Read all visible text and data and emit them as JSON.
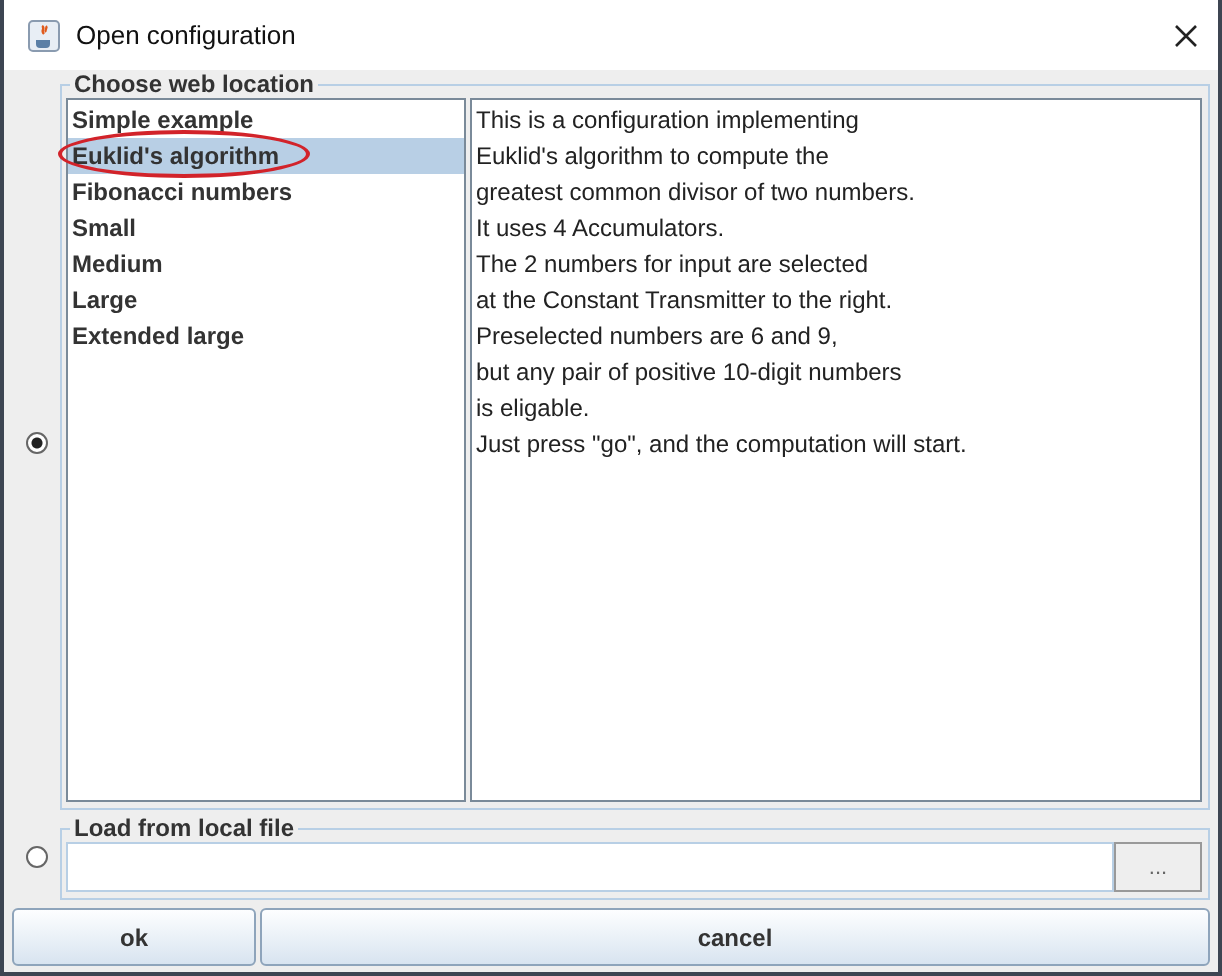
{
  "window": {
    "title": "Open configuration"
  },
  "web_location": {
    "legend": "Choose web location",
    "selected": true,
    "items": [
      {
        "label": "Simple example",
        "selected": false,
        "circled": false
      },
      {
        "label": "Euklid's algorithm",
        "selected": true,
        "circled": true
      },
      {
        "label": "Fibonacci numbers",
        "selected": false,
        "circled": false
      },
      {
        "label": "Small",
        "selected": false,
        "circled": false
      },
      {
        "label": "Medium",
        "selected": false,
        "circled": false
      },
      {
        "label": "Large",
        "selected": false,
        "circled": false
      },
      {
        "label": "Extended large",
        "selected": false,
        "circled": false
      }
    ],
    "description": [
      "This is a configuration implementing",
      "Euklid's algorithm to compute the",
      "greatest common divisor of two numbers.",
      "It uses 4 Accumulators.",
      "The 2 numbers for input are selected",
      "at the Constant Transmitter to the right.",
      "Preselected numbers are 6 and 9,",
      "but any pair of positive 10-digit numbers",
      "is eligable.",
      "Just press \"go\", and the computation will start."
    ]
  },
  "local_file": {
    "legend": "Load from local file",
    "selected": false,
    "browse_button": "..."
  },
  "buttons": [
    "ok",
    "cancel"
  ]
}
